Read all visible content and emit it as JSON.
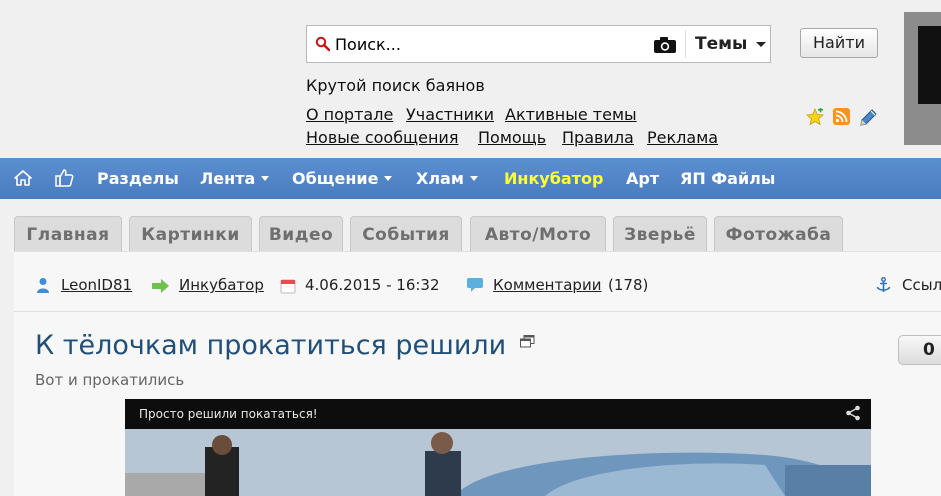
{
  "header": {
    "search": {
      "placeholder": "Поиск...",
      "topics_label": "Темы",
      "button_label": "Найти"
    },
    "tagline": "Крутой поиск баянов",
    "links_row1": [
      "О портале",
      "Участники",
      "Активные темы"
    ],
    "links_row2": [
      "Новые сообщения",
      "Помощь",
      "Правила",
      "Реклама"
    ],
    "icons": [
      "star-add-icon",
      "rss-icon",
      "pencil-icon"
    ]
  },
  "nav": {
    "items": [
      "Разделы",
      "Лента",
      "Общение",
      "Хлам",
      "Инкубатор",
      "Арт",
      "ЯП Файлы"
    ],
    "active_color": "#ffff33"
  },
  "tabs": [
    "Главная",
    "Картинки",
    "Видео",
    "События",
    "Авто/Мото",
    "Зверьё",
    "Фотожаба"
  ],
  "post": {
    "author": "LeonID81",
    "section": "Инкубатор",
    "date": "4.06.2015 - 16:32",
    "comments_label": "Комментарии",
    "comments_count": "(178)",
    "link_label": "Ссыл",
    "title": "К тёлочкам прокатиться решили",
    "subtitle": "Вот и прокатились",
    "rating": "0",
    "video_title": "Просто решили покататься!"
  },
  "colors": {
    "nav_bg": "#4f82c4",
    "title": "#1f4f7a",
    "incubator": "#ffff33"
  }
}
